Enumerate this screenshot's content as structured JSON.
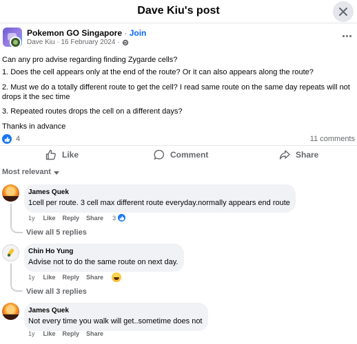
{
  "header": {
    "title": "Dave Kiu's post"
  },
  "post": {
    "group_name": "Pokemon GO Singapore",
    "separator": "·",
    "join_label": "Join",
    "meta": "Dave Kiu · 16 February 2024 ·",
    "lines": [
      "Can any pro advise regarding finding Zygarde cells?",
      "1. Does the cell appears only at the end of the route?  Or it can also appears along the route?",
      "2. Must we do a totally different route to get the cell?   I read same route on the same day repeats will not drops it the sec time",
      "3.  Repeated routes drops the cell on a different days?",
      "Thanks in advance"
    ],
    "reaction_count": "4",
    "comments_count": "11 comments"
  },
  "actions": {
    "like": "Like",
    "comment": "Comment",
    "share": "Share"
  },
  "sort_label": "Most relevant",
  "comments": [
    {
      "name": "James Quek",
      "text": "1cell per route. 3 cell max different route everyday.normally appears end route",
      "age": "1y",
      "like": "Like",
      "reply": "Reply",
      "share": "Share",
      "reactions": "3",
      "replies": "View all 5 replies"
    },
    {
      "name": "Chin Ho Yung",
      "text": "Advise not to do the same route on next day.",
      "age": "1y",
      "like": "Like",
      "reply": "Reply",
      "share": "Share",
      "replies": "View all 3 replies"
    },
    {
      "name": "James Quek",
      "text": "Not every time you walk will get..sometime does not",
      "age": "1y",
      "like": "Like",
      "reply": "Reply",
      "share": "Share"
    }
  ],
  "colors": {
    "accent": "#0866ff",
    "secondary_text": "#65676b",
    "bubble": "#f0f2f5",
    "like_blue": "#1877f2"
  },
  "icons": [
    "close-icon",
    "globe-icon",
    "more-icon",
    "like-icon",
    "comment-icon",
    "share-icon",
    "caret-down-icon",
    "like-reaction-icon",
    "haha-reaction-icon"
  ]
}
